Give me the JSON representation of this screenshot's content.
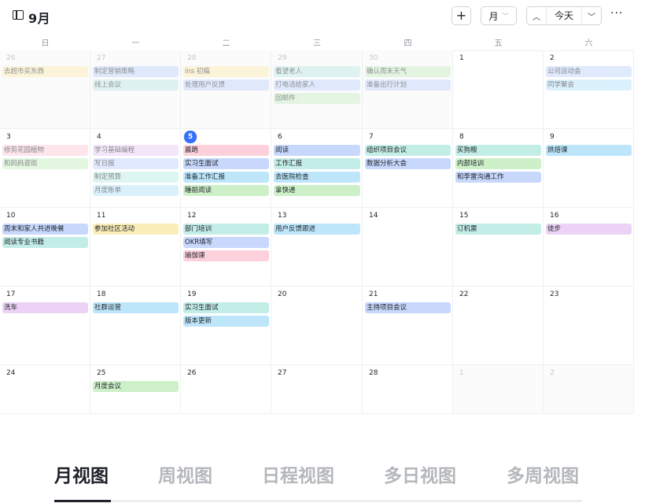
{
  "header": {
    "title": "9月",
    "add_label": "+",
    "view_label": "月",
    "view_caret": "﹀",
    "prev_label": "︿",
    "today_label": "今天",
    "next_label": "﹀",
    "more_label": "···"
  },
  "weekdays": [
    "日",
    "一",
    "二",
    "三",
    "四",
    "五",
    "六"
  ],
  "weeks": [
    [
      {
        "day": "26",
        "faded": true,
        "events": [
          {
            "title": "去超市买东西",
            "color": "yellow"
          }
        ]
      },
      {
        "day": "27",
        "faded": true,
        "events": [
          {
            "title": "制定营销策略",
            "color": "blue"
          },
          {
            "title": "线上会议",
            "color": "teal"
          }
        ]
      },
      {
        "day": "28",
        "faded": true,
        "events": [
          {
            "title": "ins 初稿",
            "color": "yellow"
          },
          {
            "title": "处理用户反馈",
            "color": "blue"
          }
        ]
      },
      {
        "day": "29",
        "faded": true,
        "events": [
          {
            "title": "看望老人",
            "color": "teal"
          },
          {
            "title": "打电话给家人",
            "color": "blue"
          },
          {
            "title": "回邮件",
            "color": "green"
          }
        ]
      },
      {
        "day": "30",
        "faded": true,
        "events": [
          {
            "title": "确认周末天气",
            "color": "green"
          },
          {
            "title": "准备出行计划",
            "color": "blue"
          }
        ]
      },
      {
        "day": "1",
        "faded": false,
        "events": []
      },
      {
        "day": "2",
        "faded": false,
        "events": [
          {
            "title": "公司运动会",
            "color": "blue",
            "soft": true
          },
          {
            "title": "同学聚会",
            "color": "sky",
            "soft": true
          }
        ]
      }
    ],
    [
      {
        "day": "3",
        "faded": false,
        "events": [
          {
            "title": "修剪花园植物",
            "color": "pink",
            "soft": true
          },
          {
            "title": "和妈妈逛街",
            "color": "green",
            "soft": true
          }
        ]
      },
      {
        "day": "4",
        "faded": false,
        "events": [
          {
            "title": "学习基础编程",
            "color": "purple",
            "soft": true
          },
          {
            "title": "写日报",
            "color": "blue",
            "soft": true
          },
          {
            "title": "制定预算",
            "color": "teal",
            "soft": true
          },
          {
            "title": "月度账单",
            "color": "sky",
            "soft": true
          }
        ]
      },
      {
        "day": "5",
        "faded": false,
        "today": true,
        "events": [
          {
            "title": "晨跑",
            "color": "pink"
          },
          {
            "title": "实习生面试",
            "color": "blue"
          },
          {
            "title": "准备工作汇报",
            "color": "sky"
          },
          {
            "title": "睡前阅读",
            "color": "green"
          }
        ]
      },
      {
        "day": "6",
        "faded": false,
        "events": [
          {
            "title": "阅读",
            "color": "blue"
          },
          {
            "title": "工作汇报",
            "color": "teal"
          },
          {
            "title": "去医院检查",
            "color": "sky"
          },
          {
            "title": "拿快递",
            "color": "green"
          }
        ]
      },
      {
        "day": "7",
        "faded": false,
        "events": [
          {
            "title": "组织项目会议",
            "color": "teal"
          },
          {
            "title": "数据分析大会",
            "color": "blue"
          }
        ]
      },
      {
        "day": "8",
        "faded": false,
        "events": [
          {
            "title": "买狗粮",
            "color": "teal"
          },
          {
            "title": "内部培训",
            "color": "green"
          },
          {
            "title": "和李雷沟通工作",
            "color": "blue"
          }
        ]
      },
      {
        "day": "9",
        "faded": false,
        "events": [
          {
            "title": "烘焙课",
            "color": "sky"
          }
        ]
      }
    ],
    [
      {
        "day": "10",
        "faded": false,
        "events": [
          {
            "title": "周末和家人共进晚餐",
            "color": "blue"
          },
          {
            "title": "阅读专业书籍",
            "color": "teal"
          }
        ]
      },
      {
        "day": "11",
        "faded": false,
        "events": [
          {
            "title": "参加社区活动",
            "color": "yellow"
          }
        ]
      },
      {
        "day": "12",
        "faded": false,
        "events": [
          {
            "title": "部门培训",
            "color": "teal"
          },
          {
            "title": "OKR填写",
            "color": "blue"
          },
          {
            "title": "瑜伽课",
            "color": "pink"
          }
        ]
      },
      {
        "day": "13",
        "faded": false,
        "events": [
          {
            "title": "用户反馈跟进",
            "color": "sky"
          }
        ]
      },
      {
        "day": "14",
        "faded": false,
        "events": []
      },
      {
        "day": "15",
        "faded": false,
        "events": [
          {
            "title": "订机票",
            "color": "teal"
          }
        ]
      },
      {
        "day": "16",
        "faded": false,
        "events": [
          {
            "title": "徒步",
            "color": "purple"
          }
        ]
      }
    ],
    [
      {
        "day": "17",
        "faded": false,
        "events": [
          {
            "title": "洗车",
            "color": "purple"
          }
        ]
      },
      {
        "day": "18",
        "faded": false,
        "events": [
          {
            "title": "社群运营",
            "color": "sky"
          }
        ]
      },
      {
        "day": "19",
        "faded": false,
        "events": [
          {
            "title": "实习生面试",
            "color": "teal"
          },
          {
            "title": "版本更新",
            "color": "sky"
          }
        ]
      },
      {
        "day": "20",
        "faded": false,
        "events": []
      },
      {
        "day": "21",
        "faded": false,
        "events": [
          {
            "title": "主持项目会议",
            "color": "blue"
          }
        ]
      },
      {
        "day": "22",
        "faded": false,
        "events": []
      },
      {
        "day": "23",
        "faded": false,
        "events": []
      }
    ],
    [
      {
        "day": "24",
        "faded": false,
        "events": []
      },
      {
        "day": "25",
        "faded": false,
        "events": [
          {
            "title": "月度会议",
            "color": "green"
          }
        ]
      },
      {
        "day": "26",
        "faded": false,
        "events": []
      },
      {
        "day": "27",
        "faded": false,
        "events": []
      },
      {
        "day": "28",
        "faded": false,
        "events": []
      },
      {
        "day": "1",
        "faded": true,
        "events": []
      },
      {
        "day": "2",
        "faded": true,
        "events": []
      }
    ]
  ],
  "tabs": [
    {
      "label": "月视图",
      "active": true
    },
    {
      "label": "周视图",
      "active": false
    },
    {
      "label": "日程视图",
      "active": false
    },
    {
      "label": "多日视图",
      "active": false
    },
    {
      "label": "多周视图",
      "active": false
    }
  ]
}
